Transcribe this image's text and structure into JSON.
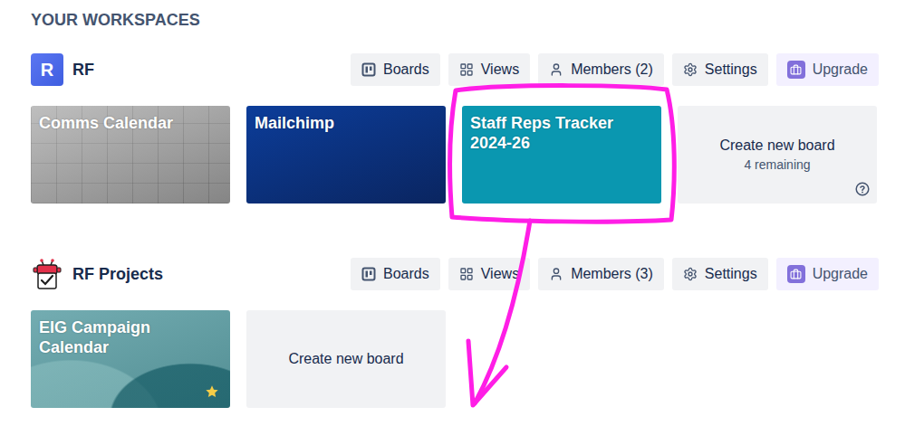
{
  "page": {
    "title": "YOUR WORKSPACES"
  },
  "workspaces": [
    {
      "name": "RF",
      "logo": {
        "kind": "letter",
        "text": "R"
      },
      "buttons": [
        {
          "label": "Boards",
          "kind": "boards"
        },
        {
          "label": "Views",
          "kind": "views"
        },
        {
          "label": "Members (2)",
          "kind": "members"
        },
        {
          "label": "Settings",
          "kind": "settings"
        },
        {
          "label": "Upgrade",
          "kind": "upgrade"
        }
      ],
      "boards": [
        {
          "title": "Comms Calendar",
          "starred": false,
          "kind": "photo",
          "color": "#9c9c9c"
        },
        {
          "title": "Mailchimp",
          "starred": false,
          "kind": "gradient",
          "color": "#0c3d9a"
        },
        {
          "title": "Staff Reps Tracker 2024-26",
          "starred": false,
          "kind": "solid",
          "color": "#0a97b0"
        }
      ],
      "create": {
        "label": "Create new board",
        "remaining": "4 remaining"
      }
    },
    {
      "name": "RF Projects",
      "logo": {
        "kind": "icon",
        "text": ""
      },
      "buttons": [
        {
          "label": "Boards",
          "kind": "boards"
        },
        {
          "label": "Views",
          "kind": "views"
        },
        {
          "label": "Members (3)",
          "kind": "members"
        },
        {
          "label": "Settings",
          "kind": "settings"
        },
        {
          "label": "Upgrade",
          "kind": "upgrade"
        }
      ],
      "boards": [
        {
          "title": "EIG Campaign Calendar",
          "starred": true,
          "kind": "waves",
          "color": "#5b9ea4"
        }
      ],
      "create": {
        "label": "Create new board",
        "remaining": ""
      }
    }
  ]
}
